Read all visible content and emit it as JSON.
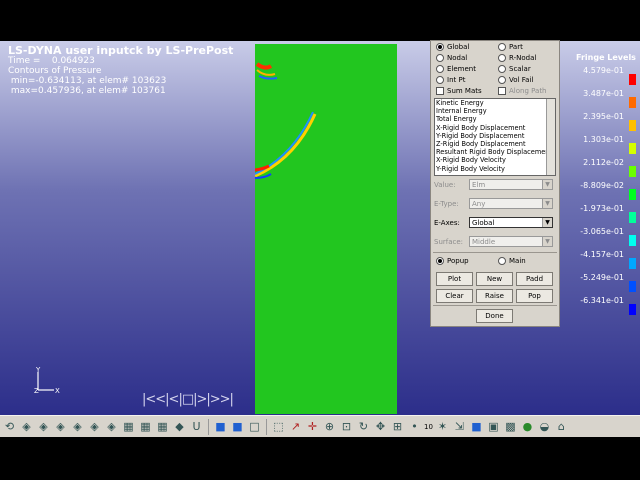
{
  "viewer": {
    "title": "LS-DYNA user inputck by LS-PrePost",
    "time_line": "Time =    0.064923",
    "contour_line": "Contours of Pressure",
    "min_line": " min=-0.634113, at elem# 103623",
    "max_line": " max=0.457936, at elem# 103761",
    "axis_y": "Y",
    "axis_z": "Z",
    "axis_x": "X",
    "vcr_controls": "|<<|<|□|>|>>|"
  },
  "panel": {
    "radios": [
      {
        "label": "Global",
        "selected": true
      },
      {
        "label": "Part",
        "selected": false
      },
      {
        "label": "Nodal",
        "selected": false
      },
      {
        "label": "R-Nodal",
        "selected": false
      },
      {
        "label": "Element",
        "selected": false
      },
      {
        "label": "Scalar",
        "selected": false
      },
      {
        "label": "Int Pt",
        "selected": false
      },
      {
        "label": "Vol Fail",
        "selected": false
      }
    ],
    "sum_mats": "Sum Mats",
    "along_path": "Along Path",
    "list_items": [
      "Kinetic Energy",
      "Internal Energy",
      "Total Energy",
      "X-Rigid Body Displacement",
      "Y-Rigid Body Displacement",
      "Z-Rigid Body Displacement",
      "Resultant Rigid Body Displacement",
      "X-Rigid Body Velocity",
      "Y-Rigid Body Velocity"
    ],
    "value_label": "Value:",
    "value_selected": "Elm",
    "etype_label": "E-Type:",
    "etype_selected": "Any",
    "eaxes_label": "E-Axes:",
    "eaxes_selected": "Global",
    "surface_label": "Surface:",
    "surface_selected": "Middle",
    "popup": "Popup",
    "main": "Main",
    "buttons": {
      "plot": "Plot",
      "new": "New",
      "padd": "Padd",
      "clear": "Clear",
      "raise": "Raise",
      "pop": "Pop",
      "done": "Done"
    }
  },
  "fringe": {
    "title": "Fringe Levels",
    "levels": [
      {
        "value": "4.579e-01",
        "color": "#ff0000"
      },
      {
        "value": "3.487e-01",
        "color": "#ff6a00"
      },
      {
        "value": "2.395e-01",
        "color": "#ffc000"
      },
      {
        "value": "1.303e-01",
        "color": "#d4ff00"
      },
      {
        "value": "2.112e-02",
        "color": "#6aff00"
      },
      {
        "value": "-8.809e-02",
        "color": "#00ff20"
      },
      {
        "value": "-1.973e-01",
        "color": "#00ff9a"
      },
      {
        "value": "-3.065e-01",
        "color": "#00fff0"
      },
      {
        "value": "-4.157e-01",
        "color": "#00a8ff"
      },
      {
        "value": "-5.249e-01",
        "color": "#0050ff"
      },
      {
        "value": "-6.341e-01",
        "color": "#0000ff"
      }
    ]
  },
  "toolbar": {
    "counter": "10"
  },
  "colors": {
    "model_green": "#22c61f",
    "panel_bg": "#d8d4cc"
  }
}
